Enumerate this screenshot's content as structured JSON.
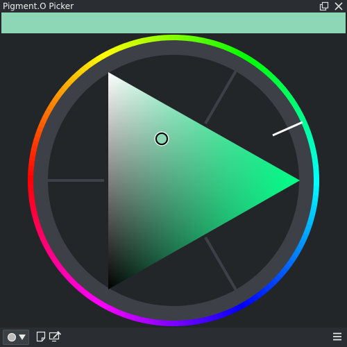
{
  "window": {
    "title": "Pigment.O Picker",
    "float_icon": "float-window-icon",
    "close_icon": "close-icon"
  },
  "current_color": {
    "hex": "#8dd7b7"
  },
  "wheel": {
    "hue_ring_colors": [
      "#ff0000",
      "#ffff00",
      "#00ff00",
      "#00ffff",
      "#0000ff",
      "#ff00ff",
      "#ff0000"
    ],
    "hue_color": "#00ff88",
    "ring_background": "#3d4147",
    "background": "#232629"
  },
  "toolbar": {
    "mode_icon": "circle-mode-icon",
    "dropdown_icon": "triangle-down-icon",
    "note_icon": "note-icon",
    "picker_icon": "screen-picker-icon",
    "menu_icon": "hamburger-menu-icon"
  }
}
